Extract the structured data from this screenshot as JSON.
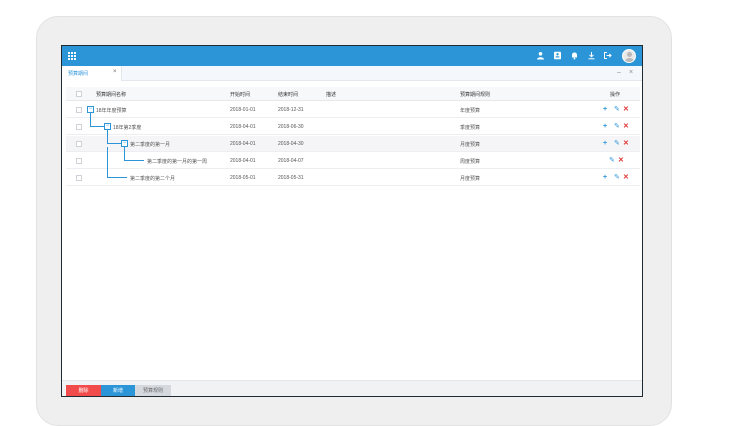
{
  "topbar": {
    "icons": [
      "apps-icon",
      "user-icon",
      "contact-card-icon",
      "bell-icon",
      "download-icon",
      "logout-icon",
      "avatar"
    ]
  },
  "tabs": [
    {
      "label": "预算期间",
      "close": "×"
    }
  ],
  "window_controls": {
    "minimize": "–",
    "close": "×"
  },
  "table": {
    "headers": {
      "name": "预算期间名称",
      "start": "开始时间",
      "end": "结束时间",
      "desc": "描述",
      "rule": "预算期间规则",
      "ops": "操作"
    },
    "rows": [
      {
        "name": "18年年度预算",
        "start": "2018-01-01",
        "end": "2018-12-31",
        "desc": "",
        "rule": "年度预算",
        "toggle": "−",
        "actions": [
          "add",
          "edit",
          "delete"
        ]
      },
      {
        "name": "18年第2季度",
        "start": "2018-04-01",
        "end": "2018-06-30",
        "desc": "",
        "rule": "季度预算",
        "toggle": "−",
        "actions": [
          "add",
          "edit",
          "delete"
        ]
      },
      {
        "name": "第二季度的第一月",
        "start": "2018-04-01",
        "end": "2018-04-30",
        "desc": "",
        "rule": "月度预算",
        "toggle": "−",
        "actions": [
          "add",
          "edit",
          "delete"
        ]
      },
      {
        "name": "第二季度的第一月的第一周",
        "start": "2018-04-01",
        "end": "2018-04-07",
        "desc": "",
        "rule": "周度预算",
        "toggle": "",
        "actions": [
          "edit",
          "delete"
        ]
      },
      {
        "name": "第二季度的第二个月",
        "start": "2018-05-01",
        "end": "2018-05-31",
        "desc": "",
        "rule": "月度预算",
        "toggle": "",
        "actions": [
          "add",
          "edit",
          "delete"
        ]
      }
    ]
  },
  "action_glyphs": {
    "add": "+",
    "edit": "✎",
    "delete": "✕"
  },
  "footer": {
    "delete_label": "删除",
    "add_label": "新增",
    "rule_label": "预算规则"
  },
  "colors": {
    "primary": "#2b95d8",
    "danger": "#f24b4b",
    "disabled": "#d5d9de"
  }
}
